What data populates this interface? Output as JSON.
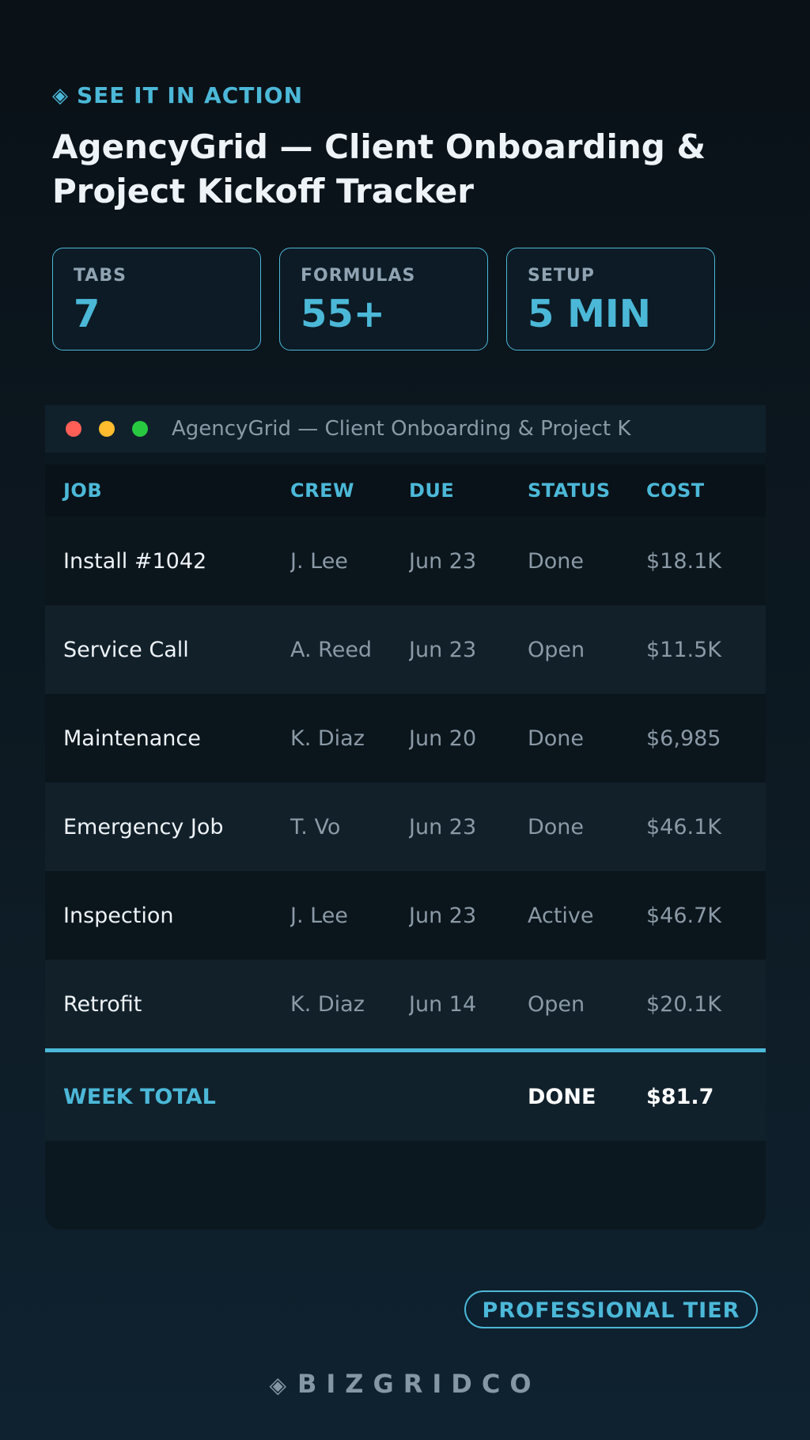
{
  "eyebrow": {
    "icon": "diamond-icon",
    "text": "SEE IT IN ACTION"
  },
  "title": "AgencyGrid — Client Onboarding & Project Kickoff Tracker",
  "stats": [
    {
      "label": "TABS",
      "value": "7"
    },
    {
      "label": "FORMULAS",
      "value": "55+"
    },
    {
      "label": "SETUP",
      "value": "5 MIN"
    }
  ],
  "window": {
    "title": "AgencyGrid — Client Onboarding & Project K",
    "controls": [
      "close",
      "minimize",
      "maximize"
    ]
  },
  "table": {
    "columns": [
      "JOB",
      "CREW",
      "DUE",
      "STATUS",
      "COST"
    ],
    "rows": [
      [
        "Install #1042",
        "J. Lee",
        "Jun 23",
        "Done",
        "$18.1K"
      ],
      [
        "Service Call",
        "A. Reed",
        "Jun 23",
        "Open",
        "$11.5K"
      ],
      [
        "Maintenance",
        "K. Diaz",
        "Jun 20",
        "Done",
        "$6,985"
      ],
      [
        "Emergency Job",
        "T. Vo",
        "Jun 23",
        "Done",
        "$46.1K"
      ],
      [
        "Inspection",
        "J. Lee",
        "Jun 23",
        "Active",
        "$46.7K"
      ],
      [
        "Retrofit",
        "K. Diaz",
        "Jun 14",
        "Open",
        "$20.1K"
      ]
    ],
    "total": {
      "label": "WEEK TOTAL",
      "status": "DONE",
      "cost": "$81.7"
    }
  },
  "tier_badge": "PROFESSIONAL TIER",
  "brand": {
    "icon": "diamond-icon",
    "text": "BIZGRIDCO"
  },
  "colors": {
    "accent": "#4cb8d8",
    "background": "#0a1117",
    "close": "#ff5f57",
    "minimize": "#febc2e",
    "maximize": "#28c840"
  }
}
